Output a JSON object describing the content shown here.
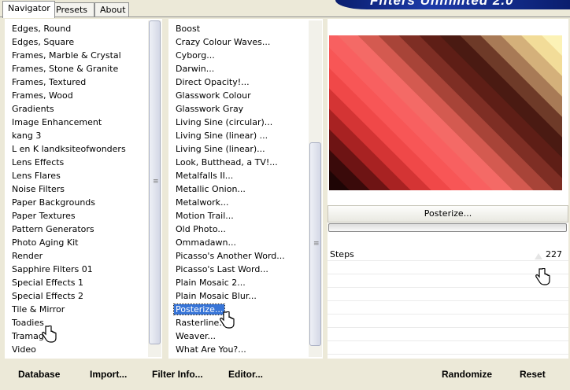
{
  "tabs": [
    {
      "label": "Navigator",
      "active": true
    },
    {
      "label": "Presets",
      "active": false
    },
    {
      "label": "About",
      "active": false
    }
  ],
  "app_title": "Filters Unlimited 2.0",
  "categories": [
    "Edges, Round",
    "Edges, Square",
    "Frames, Marble & Crystal",
    "Frames, Stone & Granite",
    "Frames, Textured",
    "Frames, Wood",
    "Gradients",
    "Image Enhancement",
    "kang 3",
    "L en K landksiteofwonders",
    "Lens Effects",
    "Lens Flares",
    "Noise Filters",
    "Paper Backgrounds",
    "Paper Textures",
    "Pattern Generators",
    "Photo Aging Kit",
    "Render",
    "Sapphire Filters 01",
    "Special Effects 1",
    "Special Effects 2",
    "Tile & Mirror",
    "Toadies",
    "Tramages",
    "Video"
  ],
  "filters": [
    "Boost",
    "Crazy Colour Waves...",
    "Cyborg...",
    "Darwin...",
    "Direct Opacity!...",
    "Glasswork Colour",
    "Glasswork Gray",
    "Living Sine (circular)...",
    "Living Sine (linear) ...",
    "Living Sine (linear)...",
    "Look, Butthead, a TV!...",
    "Metalfalls II...",
    "Metallic Onion...",
    "Metalwork...",
    "Motion Trail...",
    "Old Photo...",
    "Ommadawn...",
    "Picasso's Another Word...",
    "Picasso's Last Word...",
    "Plain Mosaic 2...",
    "Plain Mosaic Blur...",
    "Posterize...",
    "Rasterline...",
    "Weaver...",
    "What Are You?..."
  ],
  "selected_filter_index": 21,
  "selected_color": "#3875d7",
  "preview": {
    "filter_button_label": "Posterize...",
    "stripe_colors": [
      "#1e0505",
      "#3a0a0a",
      "#6e1414",
      "#a82222",
      "#d43434",
      "#f04848",
      "#f85656",
      "#f86060",
      "#f46a66",
      "#d45a50",
      "#a84438",
      "#7e2e24",
      "#5e1e16",
      "#4a1a12",
      "#6e3a28",
      "#a87a56",
      "#d4b07a",
      "#f2dc98",
      "#fcf2b6"
    ]
  },
  "params": [
    {
      "label": "Steps",
      "value": "227"
    }
  ],
  "bottom_left": {
    "database": "Database",
    "import": "Import...",
    "filter_info": "Filter Info...",
    "editor": "Editor..."
  },
  "bottom_right": {
    "randomize": "Randomize",
    "reset": "Reset"
  },
  "icons": [
    "hand-cursor-icon",
    "scroll-grip-icon"
  ]
}
